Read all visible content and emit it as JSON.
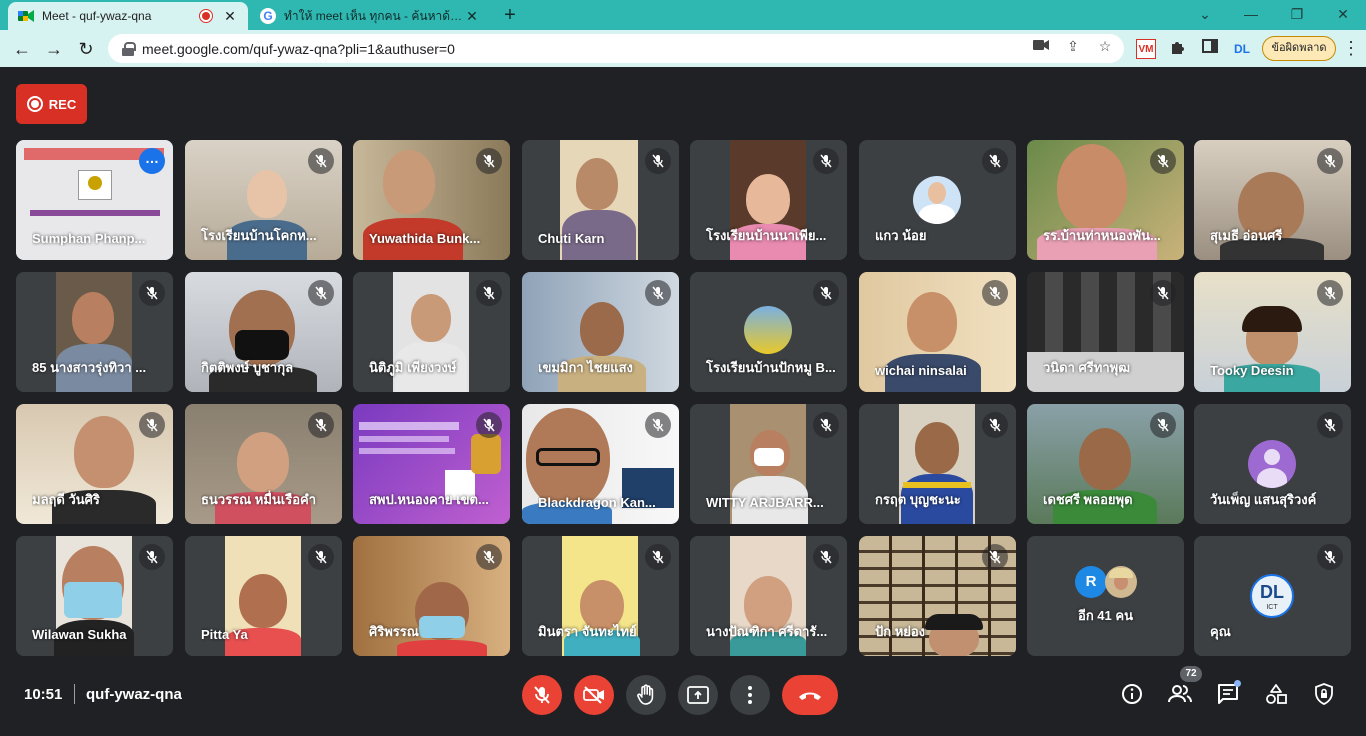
{
  "browser": {
    "tabs": [
      {
        "title": "Meet - quf-ywaz-qna",
        "active": true
      },
      {
        "title": "ทำให้ meet เห็น ทุกคน - ค้นหาด้วย Google",
        "active": false
      }
    ],
    "new_tab": "+",
    "url": "meet.google.com/quf-ywaz-qna?pli=1&authuser=0",
    "error_button": "ข้อผิดพลาด",
    "extension_vm": "VM",
    "extension_dl": "DL"
  },
  "recording": {
    "label": "REC"
  },
  "participants": [
    {
      "name": "Sumphan Phanp...",
      "pinned": true,
      "muted": false
    },
    {
      "name": "โรงเรียนบ้านโคกห...",
      "muted": true
    },
    {
      "name": "Yuwathida Bunk...",
      "muted": true
    },
    {
      "name": "Chuti Karn",
      "muted": true
    },
    {
      "name": "โรงเรียนบ้านนาเพีย...",
      "muted": true
    },
    {
      "name": "แกว น้อย",
      "muted": true
    },
    {
      "name": "รร.บ้านท่าหนองพัน...",
      "muted": true
    },
    {
      "name": "สุเมธี อ่อนศรี",
      "muted": true
    },
    {
      "name": "85 นางสาวรุ่งทิวา ...",
      "muted": true
    },
    {
      "name": "กิตติพงษ์ บูชากุล",
      "muted": true
    },
    {
      "name": "นิติภูมิ เพียงวงษ์",
      "muted": true
    },
    {
      "name": "เขมมิกา ไชยแสง",
      "muted": true
    },
    {
      "name": "โรงเรียนบ้านปักหมู B...",
      "muted": true
    },
    {
      "name": "wichai ninsalai",
      "muted": true
    },
    {
      "name": "วนิดา ศรีทาพุฒ",
      "muted": true
    },
    {
      "name": "Tooky Deesin",
      "muted": true
    },
    {
      "name": "มลฤดี วันศิริ",
      "muted": true
    },
    {
      "name": "ธนวรรณ หมื่นเรือคำ",
      "muted": true
    },
    {
      "name": "สพป.หนองคาย เขต...",
      "muted": true
    },
    {
      "name": "Blackdragon Kan...",
      "muted": true
    },
    {
      "name": "WITTY ARJBARR...",
      "muted": true
    },
    {
      "name": "กรฤต บุญชะนะ",
      "muted": true
    },
    {
      "name": "เดชศรี พลอยพุด",
      "muted": true
    },
    {
      "name": "วันเพ็ญ แสนสุริวงค์",
      "muted": true
    },
    {
      "name": "Wilawan Sukha",
      "muted": true
    },
    {
      "name": "Pitta Ya",
      "muted": true
    },
    {
      "name": "ศิริพรรณ",
      "muted": true
    },
    {
      "name": "มินตรา จันทะไทย์",
      "muted": true
    },
    {
      "name": "นางปัณฑิกา ศรีดารั...",
      "muted": true
    },
    {
      "name": "ปัก หย่อง",
      "muted": true
    },
    {
      "name": "อีก 41 คน",
      "muted": false
    },
    {
      "name": "คุณ",
      "muted": true
    }
  ],
  "others_avatar_letter": "R",
  "self_logo": "DL",
  "self_logo_sub": "ICT",
  "meeting": {
    "time": "10:51",
    "code": "quf-ywaz-qna"
  },
  "people_count": "72",
  "colors": {
    "accent_blue": "#1a73e8",
    "red": "#ea4335",
    "rec_red": "#d93025",
    "tab_teal": "#2fb8b1"
  }
}
